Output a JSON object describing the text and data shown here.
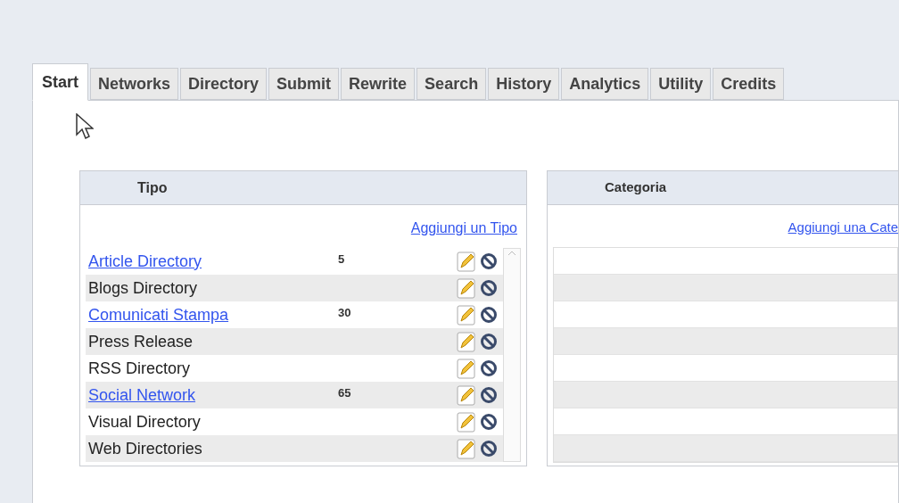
{
  "tabs": [
    {
      "label": "Start",
      "selected": true
    },
    {
      "label": "Networks",
      "selected": false
    },
    {
      "label": "Directory",
      "selected": false
    },
    {
      "label": "Submit",
      "selected": false
    },
    {
      "label": "Rewrite",
      "selected": false
    },
    {
      "label": "Search",
      "selected": false
    },
    {
      "label": "History",
      "selected": false
    },
    {
      "label": "Analytics",
      "selected": false
    },
    {
      "label": "Utility",
      "selected": false
    },
    {
      "label": "Credits",
      "selected": false
    }
  ],
  "tipo_panel": {
    "title": "Tipo",
    "add_link": "Aggiungi un Tipo",
    "rows": [
      {
        "name": "Article Directory",
        "linked": true,
        "count": "5"
      },
      {
        "name": "Blogs Directory",
        "linked": false
      },
      {
        "name": "Comunicati Stampa",
        "linked": true,
        "count": "30"
      },
      {
        "name": "Press Release",
        "linked": false
      },
      {
        "name": "RSS Directory",
        "linked": false
      },
      {
        "name": "Social Network",
        "linked": true,
        "count": "65"
      },
      {
        "name": "Visual Directory",
        "linked": false
      },
      {
        "name": "Web Directories",
        "linked": false
      }
    ]
  },
  "categoria_panel": {
    "title": "Categoria",
    "add_link": "Aggiungi una Cate"
  }
}
